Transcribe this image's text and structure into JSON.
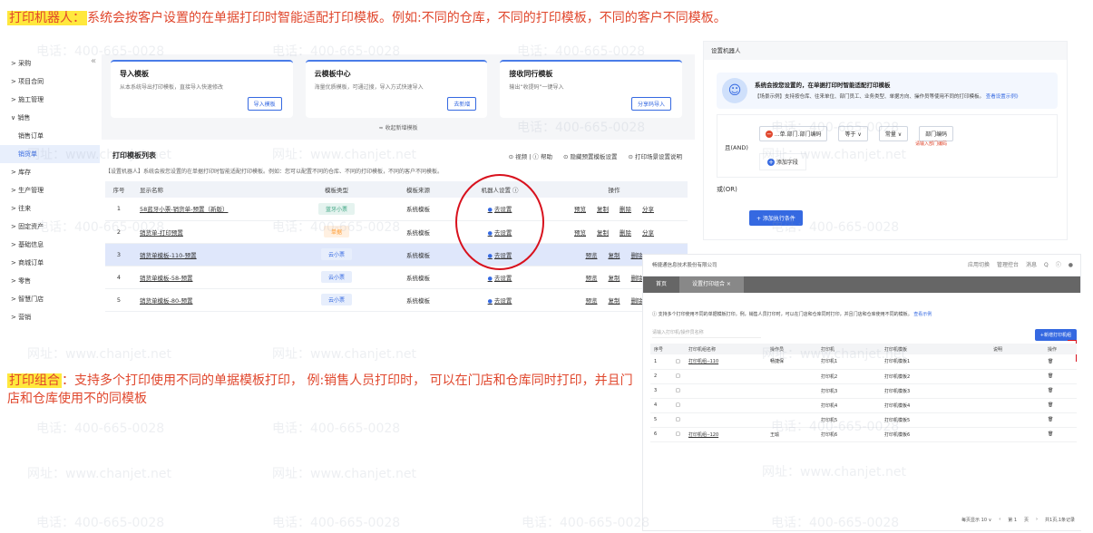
{
  "captions": {
    "top_highlight": "打印机器人：",
    "top_text": "系统会按客户设置的在单据打印时智能适配打印模板。例如:不同的仓库，不同的打印模板，不同的客户不同模板。",
    "bottom_highlight": "打印组合",
    "bottom_text": "：支持多个打印使用不同的单据模板打印， 例:销售人员打印时， 可以在门店和仓库同时打印，并且门店和仓库使用不的同模板"
  },
  "watermark": {
    "phone": "电话：400-665-0028",
    "site": "网址：www.chanjet.net"
  },
  "sidebar": {
    "items": [
      "> 采购",
      "> 项目合同",
      "> 施工管理",
      "∨ 销售",
      "销售订单",
      "销货单",
      "> 库存",
      "> 生产管理",
      "> 往来",
      "> 固定资产",
      "> 基础信息",
      "> 商城订单",
      "> 零售",
      "> 智慧门店",
      "> 营销"
    ],
    "collapse_icon": "«"
  },
  "cards": [
    {
      "title": "导入模板",
      "desc": "从本系统导出打印模板，直接导入快速修改",
      "button": "导入模板"
    },
    {
      "title": "云模板中心",
      "desc": "海量优质模板，可通过搜，导入方式快速导入",
      "button": "去新增"
    },
    {
      "title": "接收同行模板",
      "desc": "输出“收提码”一键导入",
      "button": "分享码导入"
    }
  ],
  "collapse_bar": "≈ 收起新增模板",
  "list": {
    "title": "打印模板列表",
    "links": [
      "⊙ 视频 | ⓘ 帮助",
      "⊙ 隐藏预置模板设置",
      "⊙ 打印场景设置说明"
    ],
    "desc": "【设置机器人】系统会按您设置的在单据打印时智能适配打印模板。例如：您可以配置不同的仓库、不同的打印模板，不同的客户不同模板。",
    "headers": [
      "序号",
      "显示名称",
      "模板类型",
      "模板来源",
      "机器人设置 ⓘ",
      "操作"
    ],
    "rows": [
      {
        "no": "1",
        "name": "58蓝牙小票-销货单-预置（新版）",
        "type": "蓝牙小票",
        "source": "系统模板",
        "robot": "去设置",
        "ops": [
          "预览",
          "复制",
          "删除",
          "分享"
        ]
      },
      {
        "no": "2",
        "name": "销货单-打印预置",
        "type": "单据",
        "source": "系统模板",
        "robot": "去设置",
        "ops": [
          "预览",
          "复制",
          "删除",
          "分享"
        ]
      },
      {
        "no": "3",
        "name": "销货单模板-110-预置",
        "type": "云小票",
        "source": "系统模板",
        "robot": "去设置",
        "ops": [
          "预览",
          "复制",
          "删除"
        ]
      },
      {
        "no": "4",
        "name": "销货单模板-58-预置",
        "type": "云小票",
        "source": "系统模板",
        "robot": "去设置",
        "ops": [
          "预览",
          "复制",
          "删除"
        ]
      },
      {
        "no": "5",
        "name": "销货单模板-80-预置",
        "type": "云小票",
        "source": "系统模板",
        "robot": "去设置",
        "ops": [
          "预览",
          "复制",
          "删除"
        ]
      }
    ]
  },
  "robot": {
    "top": "设置机器人",
    "banner_title": "系统会按您设置的，在单据打印时智能适配打印模板",
    "banner_desc": "【场景示例】支持按仓库、往来单位、部门员工、业务类型、单据方向、操作员等使用不同的打印模板。",
    "banner_link": "查看设置示例》",
    "and_label": "且(AND)",
    "field": "...单.部门.部门编码",
    "op1": "等于",
    "op2": "常量",
    "value": "部门编码",
    "tip": "请输入部门编码",
    "add_field": "添加字段",
    "or_label": "或(OR)",
    "add_group": "+ 添加执行条件"
  },
  "printgroup": {
    "company": "畅捷通信息技术股份有限公司",
    "top_icons": [
      "应用切换",
      "管理控台",
      "消息",
      "Q",
      "ⓘ"
    ],
    "tabs": [
      "首页",
      "设置打印组合 ×"
    ],
    "info": "ⓘ 支持多个打印使用不同的单据模板打印。例，销售人员打印时，可以在门店和仓库同时打印，并且门店和仓库使用不同的模板。",
    "info_link": "查看示例",
    "search_placeholder": "请输入打印机/操作员名称",
    "add_button": "+新增打印机组",
    "headers": [
      "序号",
      "",
      "打印机组名称",
      "操作员",
      "打印机",
      "打印机模板",
      "说明",
      "操作"
    ],
    "rows": [
      {
        "no": "1",
        "name": "打印机组--110",
        "op": "畅捷保",
        "printer": "打印机1",
        "tpl": "打印机模板1"
      },
      {
        "no": "2",
        "name": "",
        "op": "",
        "printer": "打印机2",
        "tpl": "打印机模板2"
      },
      {
        "no": "3",
        "name": "",
        "op": "",
        "printer": "打印机3",
        "tpl": "打印机模板3"
      },
      {
        "no": "4",
        "name": "",
        "op": "",
        "printer": "打印机4",
        "tpl": "打印机模板4"
      },
      {
        "no": "5",
        "name": "",
        "op": "",
        "printer": "打印机5",
        "tpl": "打印机模板5"
      },
      {
        "no": "6",
        "name": "打印机组--120",
        "op": "王瑜",
        "printer": "打印机6",
        "tpl": "打印机模板6"
      }
    ],
    "pager": [
      "每页显示 10 ∨",
      "‹",
      "第 1",
      "页",
      "›",
      "共1页,1条记录"
    ]
  }
}
